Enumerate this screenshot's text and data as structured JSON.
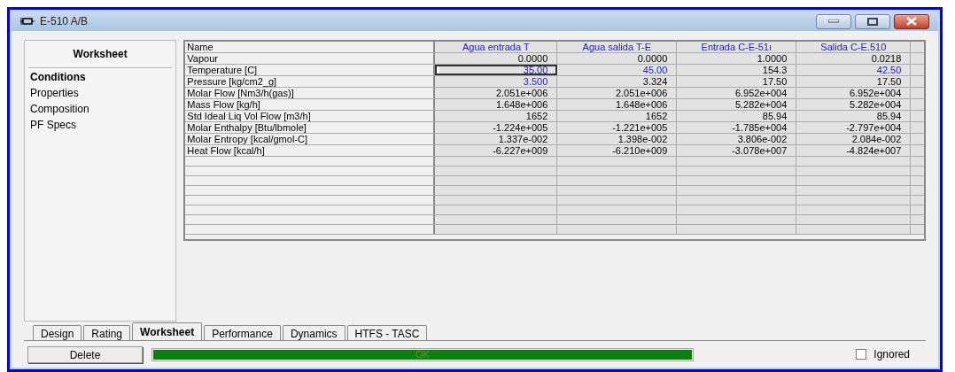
{
  "window": {
    "title": "E-510 A/B"
  },
  "sidebar": {
    "heading": "Worksheet",
    "items": [
      {
        "label": "Conditions",
        "selected": true
      },
      {
        "label": "Properties",
        "selected": false
      },
      {
        "label": "Composition",
        "selected": false
      },
      {
        "label": "PF Specs",
        "selected": false
      }
    ]
  },
  "table": {
    "corner": "Name",
    "columns": [
      "Agua entrada T",
      "Agua salida T-E",
      "Entrada C-E-51ı",
      "Salida C-E.510"
    ],
    "rows": [
      {
        "label": "Vapour",
        "cells": [
          {
            "text": "0.0000",
            "specified": false,
            "focused": false
          },
          {
            "text": "0.0000",
            "specified": false,
            "focused": false
          },
          {
            "text": "1.0000",
            "specified": false,
            "focused": false
          },
          {
            "text": "0.0218",
            "specified": false,
            "focused": false
          }
        ]
      },
      {
        "label": "Temperature [C]",
        "cells": [
          {
            "text": "35.00",
            "specified": true,
            "focused": true
          },
          {
            "text": "45.00",
            "specified": true,
            "focused": false
          },
          {
            "text": "154.3",
            "specified": false,
            "focused": false
          },
          {
            "text": "42.50",
            "specified": true,
            "focused": false
          }
        ]
      },
      {
        "label": "Pressure [kg/cm2_g]",
        "cells": [
          {
            "text": "3.500",
            "specified": true,
            "focused": false
          },
          {
            "text": "3.324",
            "specified": false,
            "focused": false
          },
          {
            "text": "17.50",
            "specified": false,
            "focused": false
          },
          {
            "text": "17.50",
            "specified": false,
            "focused": false
          }
        ]
      },
      {
        "label": "Molar Flow [Nm3/h(gas)]",
        "cells": [
          {
            "text": "2.051e+006",
            "specified": false,
            "focused": false
          },
          {
            "text": "2.051e+006",
            "specified": false,
            "focused": false
          },
          {
            "text": "6.952e+004",
            "specified": false,
            "focused": false
          },
          {
            "text": "6.952e+004",
            "specified": false,
            "focused": false
          }
        ]
      },
      {
        "label": "Mass Flow [kg/h]",
        "cells": [
          {
            "text": "1.648e+006",
            "specified": false,
            "focused": false
          },
          {
            "text": "1.648e+006",
            "specified": false,
            "focused": false
          },
          {
            "text": "5.282e+004",
            "specified": false,
            "focused": false
          },
          {
            "text": "5.282e+004",
            "specified": false,
            "focused": false
          }
        ]
      },
      {
        "label": "Std Ideal Liq Vol Flow [m3/h]",
        "cells": [
          {
            "text": "1652",
            "specified": false,
            "focused": false
          },
          {
            "text": "1652",
            "specified": false,
            "focused": false
          },
          {
            "text": "85.94",
            "specified": false,
            "focused": false
          },
          {
            "text": "85.94",
            "specified": false,
            "focused": false
          }
        ]
      },
      {
        "label": "Molar Enthalpy [Btu/lbmole]",
        "cells": [
          {
            "text": "-1.224e+005",
            "specified": false,
            "focused": false
          },
          {
            "text": "-1.221e+005",
            "specified": false,
            "focused": false
          },
          {
            "text": "-1.785e+004",
            "specified": false,
            "focused": false
          },
          {
            "text": "-2.797e+004",
            "specified": false,
            "focused": false
          }
        ]
      },
      {
        "label": "Molar Entropy [kcal/gmol-C]",
        "cells": [
          {
            "text": "1.337e-002",
            "specified": false,
            "focused": false
          },
          {
            "text": "1.398e-002",
            "specified": false,
            "focused": false
          },
          {
            "text": "3.806e-002",
            "specified": false,
            "focused": false
          },
          {
            "text": "2.084e-002",
            "specified": false,
            "focused": false
          }
        ]
      },
      {
        "label": "Heat Flow [kcal/h]",
        "cells": [
          {
            "text": "-6.227e+009",
            "specified": false,
            "focused": false
          },
          {
            "text": "-6.210e+009",
            "specified": false,
            "focused": false
          },
          {
            "text": "-3.078e+007",
            "specified": false,
            "focused": false
          },
          {
            "text": "-4.824e+007",
            "specified": false,
            "focused": false
          }
        ]
      }
    ]
  },
  "tabs": [
    {
      "label": "Design",
      "selected": false
    },
    {
      "label": "Rating",
      "selected": false
    },
    {
      "label": "Worksheet",
      "selected": true
    },
    {
      "label": "Performance",
      "selected": false
    },
    {
      "label": "Dynamics",
      "selected": false
    },
    {
      "label": "HTFS - TASC",
      "selected": false
    }
  ],
  "footer": {
    "delete_button": "Delete",
    "status": {
      "text": "OK",
      "level": 1
    },
    "ignored": {
      "label": "Ignored",
      "checked": false
    }
  }
}
